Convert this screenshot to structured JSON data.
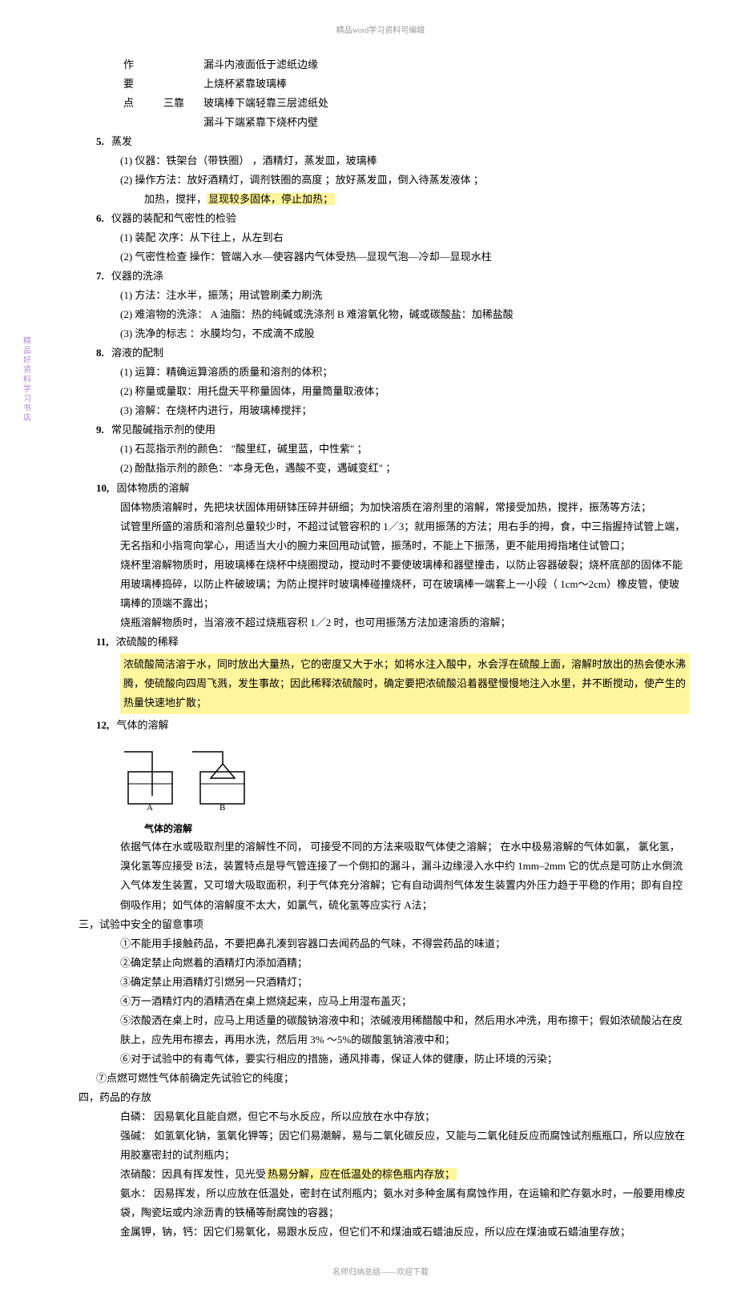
{
  "header": "精品word学习资料可编辑",
  "footer": "名师归纳总结——欢迎下载",
  "side_tag": "精品好资料学习书店",
  "req_table": {
    "r1c1": "作",
    "r1c2": "",
    "r1c3": "漏斗内液面低于滤纸边缘",
    "r2c1": "要",
    "r2c2": "",
    "r2c3": "上烧杯紧靠玻璃棒",
    "r3c1": "点",
    "r3c2": "三靠",
    "r3c3": "玻璃棒下端轻靠三层滤纸处",
    "r4c1": "",
    "r4c2": "",
    "r4c3": "漏斗下端紧靠下烧杯内壁"
  },
  "item5": {
    "num": "5.",
    "title": "蒸发",
    "l1": "(1) 仪器：铁架台（带铁圈） ，酒精灯，蒸发皿，玻璃棒",
    "l2a": "(2) 操作方法：放好酒精灯，调剂铁圈的高度  ；放好蒸发皿，倒入待蒸发液体  ；",
    "l2b_pre": "加热，搅拌，",
    "l2b_hl": "显现较多固体，停止加热；"
  },
  "item6": {
    "num": "6.",
    "title": "仪器的装配和气密性的检验",
    "l1": "(1) 装配 次序：从下往上，从左到右",
    "l2": "(2) 气密性检查 操作：管端入水—使容器内气体受热—显现气泡—冷却—显现水柱"
  },
  "item7": {
    "num": "7.",
    "title": "仪器的洗涤",
    "l1": "(1) 方法：注水半，振荡；用试管刷柔力刷洗",
    "l2": "(2) 难溶物的洗涤：  A 油脂：热的纯碱或洗涤剂  B  难溶氧化物，碱或碳酸盐：加稀盐酸",
    "l3": "(3) 洗净的标志 ：水膜均匀，不成滴不成股"
  },
  "item8": {
    "num": "8.",
    "title": "溶液的配制",
    "l1": "(1) 运算：精确运算溶质的质量和溶剂的体积；",
    "l2": "(2) 称量或量取：用托盘天平称量固体，用量筒量取液体；",
    "l3": "(3) 溶解：在烧杯内进行，用玻璃棒搅拌；"
  },
  "item9": {
    "num": "9.",
    "title": "常见酸碱指示剂的使用",
    "l1": "(1) 石蕊指示剂的颜色： \"酸里红，碱里蓝，中性紫\"  ；",
    "l2": "(2) 酚酞指示剂的颜色：\"本身无色，遇酸不变，遇碱变红\"  ；"
  },
  "item10": {
    "num": "10,",
    "title": "固体物质的溶解",
    "p1": "固体物质溶解时，先把块状固体用研钵压碎并研细；为加快溶质在溶剂里的溶解，常接受加热，搅拌，振荡等方法；",
    "p2": "试管里所盛的溶质和溶剂总量较少时，不超过试管容积的    1／3；就用振荡的方法；用右手的拇，食，中三指握持试管上端，无名指和小指弯向掌心，用适当大小的腕力来回甩动试管，振荡时，不能上下振荡，更不能用拇指堵住试管口；",
    "p3": "烧杯里溶解物质时，用玻璃棒在烧杯中绕圈搅动，搅动时不要使玻璃棒和器壁撞击，以防止容器破裂；烧杯底部的固体不能用玻璃棒捣碎，以防止杵破玻璃；为防止搅拌时玻璃棒碰撞烧杯，可在玻璃棒一端套上一小段（    1cm～2cm）橡皮管，使玻璃棒的顶端不露出；",
    "p4": "烧瓶溶解物质时，当溶液不超过烧瓶容积    1／2 时，也可用振荡方法加速溶质的溶解；"
  },
  "item11": {
    "num": "11,",
    "title": "浓硫酸的稀释",
    "p_hl": "浓硫酸简洁溶于水，同时放出大量热，它的密度又大于水；如将水注入酸中，水会浮在硫酸上面，溶解时放出的热会使水沸腾，使硫酸向四周飞溅，发生事故；因此稀释浓硫酸时，确定要把浓硫酸沿着器壁慢慢地注入水里，并不断搅动，使产生的热量快速地扩散；"
  },
  "item12": {
    "num": "12,",
    "title": "气体的溶解",
    "caption": "气体的溶解",
    "label_a": "A",
    "label_b": "B",
    "p": "依据气体在水或吸取剂里的溶解性不同， 可接受不同的方法来吸取气体使之溶解； 在水中极易溶解的气体如氯， 氯化氢，溴化氢等应接受  B法，装置特点是导气管连接了一个倒扣的漏斗，漏斗边缘浸入水中约    1mm–2mm 它的优点是可防止水倒流入气体发生装置，又可增大吸取面积，利于气体充分溶解；它有自动调剂气体发生装置内外压力趋于平稳的作用；即有自控倒吸作用；如气体的溶解度不太大，如氯气，硫化氢等应实行    A法；"
  },
  "sec3": {
    "head": "三，试验中安全的留意事项",
    "l1": "①不能用手接触药品，不要把鼻孔凑到容器口去闻药品的气味，不得尝药品的味道；",
    "l2": "②确定禁止向燃着的酒精灯内添加酒精；",
    "l3": "③确定禁止用酒精灯引燃另一只酒精灯；",
    "l4": "④万一酒精灯内的酒精洒在桌上燃烧起来，应马上用湿布盖灭；",
    "l5": "⑤浓酸洒在桌上时，应马上用适量的碳酸钠溶液中和；浓碱液用稀醋酸中和，然后用水冲洗，用布擦干；假如浓硫酸沾在皮肤上，应先用布擦去，再用水洗，然后用    3% ～5%的碳酸氢钠溶液中和；",
    "l6": "⑥对于试验中的有毒气体，要实行相应的措施，通风排毒，保证人体的健康，防止环境的污染；",
    "l7": "⑦点燃可燃性气体前确定先试验它的纯度；"
  },
  "sec4": {
    "head": "四，药品的存放",
    "l1": "白磷：  因易氧化且能自燃，但它不与水反应，所以应放在水中存放；",
    "l2": "强碱：  如氢氧化钠，氢氧化钾等；因它们易潮解，易与二氧化碳反应，又能与二氧化硅反应而腐蚀试剂瓶瓶口，所以应放在用胶塞密封的试剂瓶内；",
    "l3a": "浓硝酸：因具有挥发性，见光受",
    "l3hl": "热易分解，应在低温处的棕色瓶内存放；",
    "l4": "氨水：  因易挥发，所以应放在低温处，密封在试剂瓶内；氨水对多种金属有腐蚀作用，在运输和贮存氨水时，一般要用橡皮袋，陶瓷坛或内涂沥青的铁桶等耐腐蚀的容器；",
    "l5": "金属钾，钠，钙：因它们易氧化，易跟水反应，但它们不和煤油或石蜡油反应，所以应在煤油或石蜡油里存放；"
  }
}
